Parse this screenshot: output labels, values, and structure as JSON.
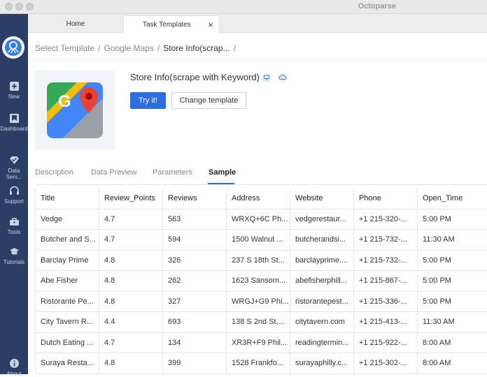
{
  "app": {
    "title": "Octoparse"
  },
  "sidebar": {
    "items": [
      {
        "label": "New",
        "icon": "plus-square-icon"
      },
      {
        "label": "Dashboard",
        "icon": "bookmark-icon"
      },
      {
        "label": "Data Serv...",
        "icon": "diamond-icon"
      },
      {
        "label": "Support",
        "icon": "headset-icon"
      },
      {
        "label": "Tools",
        "icon": "toolbox-icon"
      },
      {
        "label": "Tutorials",
        "icon": "graduation-cap-icon"
      },
      {
        "label": "About",
        "icon": "info-icon"
      }
    ]
  },
  "tabs": [
    {
      "label": "Home"
    },
    {
      "label": "Task Templates",
      "close": "×"
    }
  ],
  "breadcrumb": {
    "items": [
      "Select Template",
      "Google Maps",
      "Store Info(scrap..."
    ],
    "separator": "/"
  },
  "template": {
    "title": "Store Info(scrape with Keyword)",
    "try_label": "Try it!",
    "change_label": "Change template"
  },
  "subtabs": [
    "Description",
    "Data Preview",
    "Parameters",
    "Sample"
  ],
  "table": {
    "columns": [
      "Title",
      "Review_Points",
      "Reviews",
      "Address",
      "Website",
      "Phone",
      "Open_Time"
    ],
    "rows": [
      [
        "Vedge",
        "4.7",
        "563",
        "WRXQ+6C Ph...",
        "vedgerestaur...",
        "+1 215-320-...",
        "5:00 PM"
      ],
      [
        "Butcher and S...",
        "4.7",
        "594",
        "1500 Walnut ...",
        "butcherandsi...",
        "+1 215-732-...",
        "11:30 AM"
      ],
      [
        "Barclay Prime",
        "4.8",
        "326",
        "237 S 18th St...",
        "barclayprime....",
        "+1 215-732-...",
        "5:00 PM"
      ],
      [
        "Abe Fisher",
        "4.8",
        "262",
        "1623 Sansom...",
        "abefisherphill...",
        "+1 215-867-...",
        "5:00 PM"
      ],
      [
        "Ristorante Pe...",
        "4.8",
        "327",
        "WRGJ+G9 Phi...",
        "ristorantepest...",
        "+1 215-336-...",
        "5:00 PM"
      ],
      [
        "City Tavern R...",
        "4.4",
        "693",
        "138 S 2nd St,...",
        "citytavern.com",
        "+1 215-413-...",
        "11:30 AM"
      ],
      [
        "Dutch Eating ...",
        "4.7",
        "134",
        "XR3R+F9 Phil...",
        "readingtermin...",
        "+1 215-922-...",
        "8:00 AM"
      ],
      [
        "Suraya Resta...",
        "4.8",
        "399",
        "1528 Frankfo...",
        "surayaphilly.c...",
        "+1 215-302-...",
        "8:00 AM"
      ]
    ]
  },
  "colors": {
    "sidebar": "#2c3e66",
    "accent": "#2f6ddf"
  }
}
